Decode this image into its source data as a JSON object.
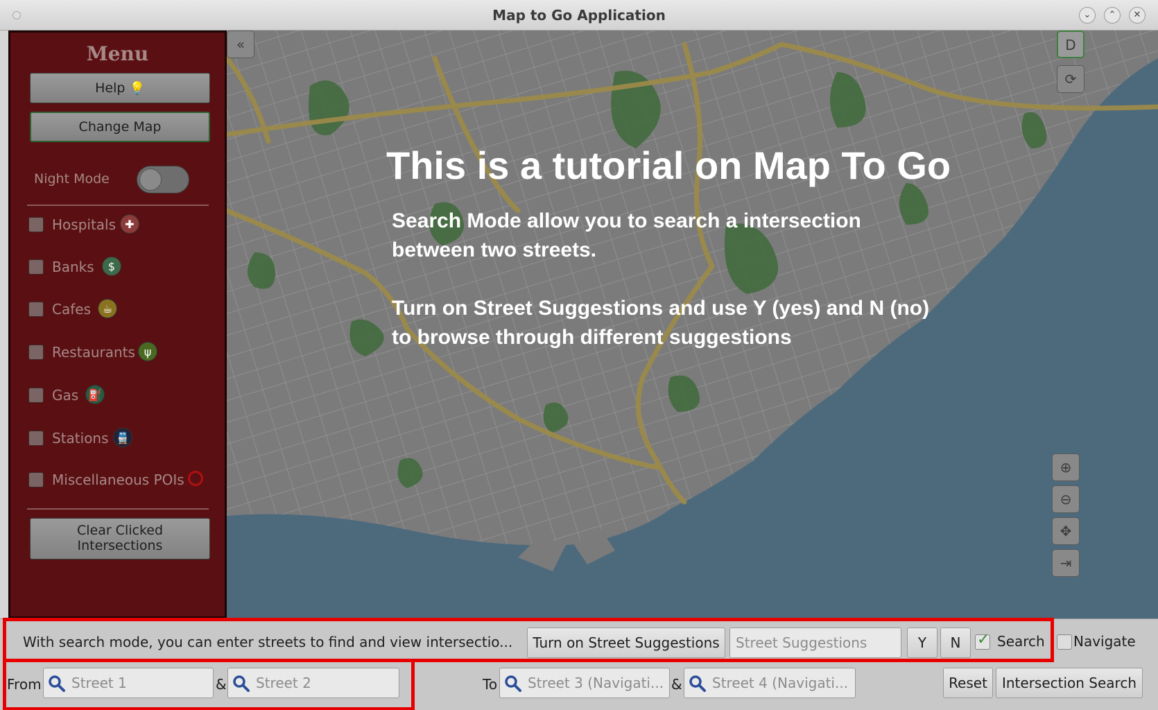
{
  "window": {
    "title": "Map to Go Application",
    "buttons": [
      "minimize",
      "maximize",
      "close"
    ]
  },
  "sidebar": {
    "title": "Menu",
    "help_label": "Help",
    "change_map_label": "Change Map",
    "night_mode_label": "Night Mode",
    "night_mode_on": false,
    "poi_items": [
      {
        "label": "Hospitals",
        "icon": "hospital-icon",
        "checked": false,
        "color": "#c8102e"
      },
      {
        "label": "Banks",
        "icon": "bank-icon",
        "checked": false,
        "color": "#3f8f56"
      },
      {
        "label": "Cafes",
        "icon": "cafe-icon",
        "checked": false,
        "color": "#d8a800"
      },
      {
        "label": "Restaurants",
        "icon": "restaurant-icon",
        "checked": false,
        "color": "#5c8f24"
      },
      {
        "label": "Gas",
        "icon": "gas-icon",
        "checked": false,
        "color": "#1f6f4a"
      },
      {
        "label": "Stations",
        "icon": "station-icon",
        "checked": false,
        "color": "#222244"
      },
      {
        "label": "Miscellaneous POIs",
        "icon": "misc-poi-icon",
        "checked": false,
        "color": "#c81010"
      }
    ],
    "clear_label_line1": "Clear Clicked",
    "clear_label_line2": "Intersections"
  },
  "map": {
    "tutorial_title": "This is a tutorial on Map To Go",
    "tutorial_line1": "Search Mode allow you to search a intersection",
    "tutorial_line2": "between two streets.",
    "tutorial_line3": "Turn on Street Suggestions and use Y (yes) and N (no)",
    "tutorial_line4": "to browse through different suggestions",
    "top_right_button": "D",
    "controls": [
      "zoom-in-icon",
      "zoom-out-icon",
      "pan-icon",
      "zoom-fit-icon"
    ]
  },
  "bottombar": {
    "info_text": "With search mode, you can enter streets to find and view intersectio...",
    "suggestions_button": "Turn on Street Suggestions",
    "suggestions_placeholder": "Street Suggestions",
    "yes_button": "Y",
    "no_button": "N",
    "search_label": "Search",
    "search_checked": true,
    "navigate_label": "Navigate",
    "navigate_checked": false,
    "from_label": "From",
    "street1_placeholder": "Street 1",
    "amp1": "&",
    "street2_placeholder": "Street 2",
    "to_label": "To",
    "street3_placeholder": "Street 3 (Navigati...",
    "amp2": "&",
    "street4_placeholder": "Street 4 (Navigati...",
    "reset_button": "Reset",
    "intersection_search_button": "Intersection Search"
  },
  "colors": {
    "highlight": "#e60000",
    "sidebar_bg": "#5a1013",
    "water": "#4d6a7d",
    "park": "#3f6e3c",
    "highway": "#9c8a4a"
  }
}
